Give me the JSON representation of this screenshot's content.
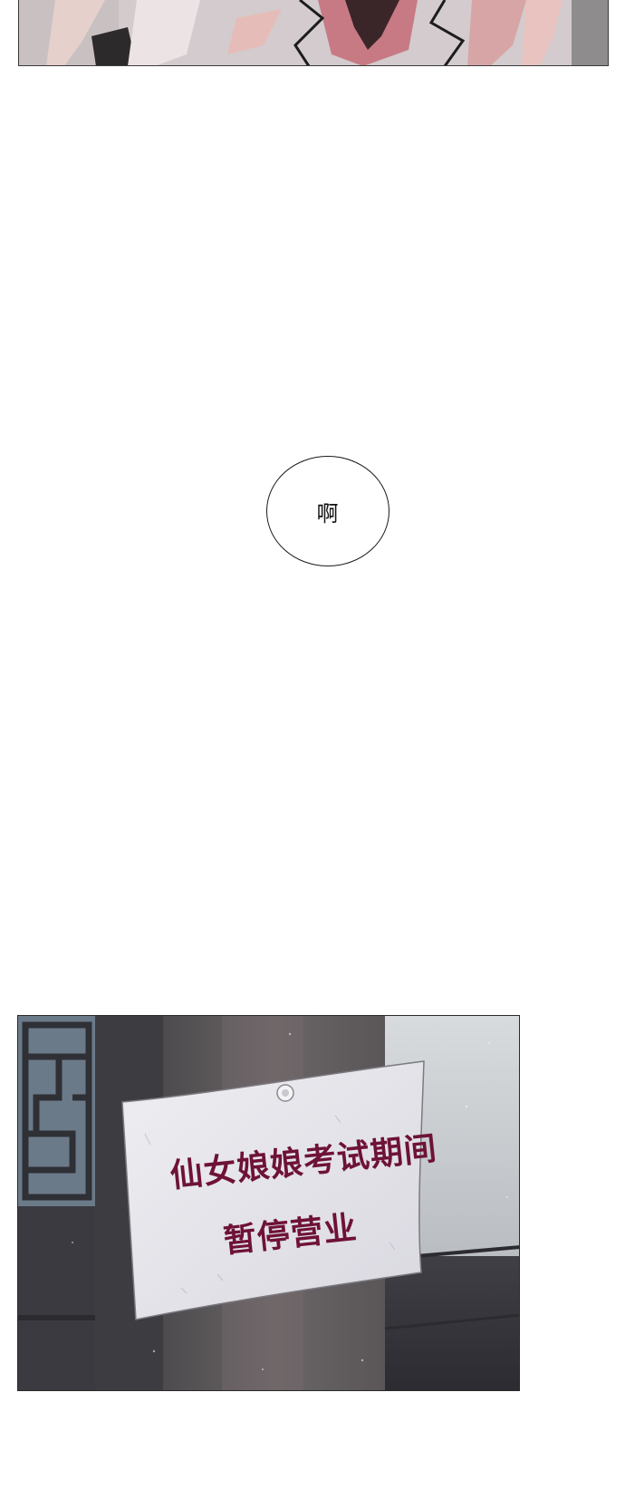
{
  "bubble": {
    "text": "啊"
  },
  "notice": {
    "line1": "仙女娘娘考试期间",
    "line2": "暂停营业"
  },
  "colors": {
    "notice_text": "#6e1236",
    "bubble_border": "#1a1a1a",
    "page_background": "#ffffff"
  }
}
